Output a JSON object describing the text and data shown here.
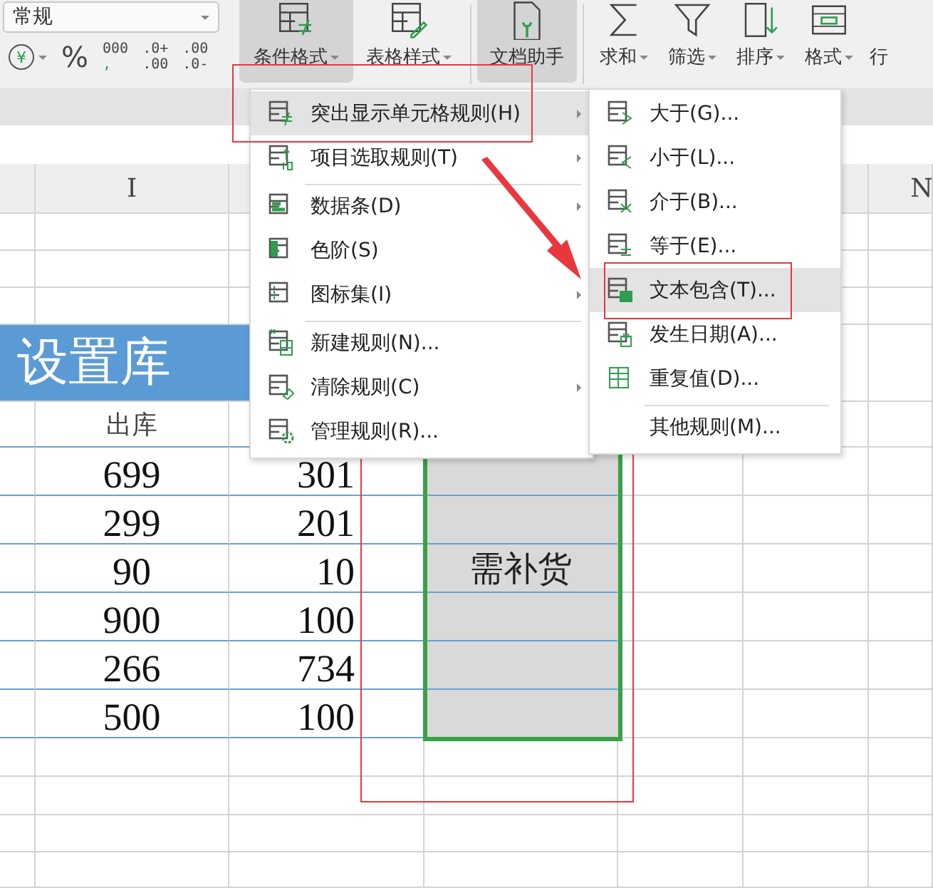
{
  "ribbon": {
    "number_format": "常规",
    "format_buttons": [
      {
        "kind": "currency",
        "label": "¥"
      },
      {
        "kind": "percent",
        "label": "%"
      },
      {
        "kind": "thousands",
        "label": "000",
        "label_2": ","
      },
      {
        "kind": "add_decimal",
        "label": ".0+",
        "label_2": ".00"
      },
      {
        "kind": "remove_decimal",
        "label": ".00",
        "label_2": ".0-"
      }
    ],
    "tools": [
      {
        "kind": "conditional",
        "label": "条件格式",
        "highlighted": true,
        "dropdown": true
      },
      {
        "kind": "table_style",
        "label": "表格样式",
        "highlighted": false,
        "dropdown": true
      },
      {
        "kind": "doc_helper",
        "label": "文档助手",
        "highlighted": true,
        "dropdown": false
      },
      {
        "kind": "sum",
        "label": "求和",
        "highlighted": false,
        "dropdown": true
      },
      {
        "kind": "filter",
        "label": "筛选",
        "highlighted": false,
        "dropdown": true
      },
      {
        "kind": "sort",
        "label": "排序",
        "highlighted": false,
        "dropdown": true
      },
      {
        "kind": "format",
        "label": "格式",
        "highlighted": false,
        "dropdown": true
      },
      {
        "kind": "row",
        "label": "行",
        "highlighted": false,
        "dropdown": false
      }
    ]
  },
  "sheet": {
    "column_headers": [
      "I",
      "N"
    ],
    "title": "设置库",
    "header": "出库",
    "rows": [
      {
        "cells": [
          "699",
          "301"
        ],
        "flagged": true
      },
      {
        "cells": [
          "299",
          "201"
        ],
        "flagged": true
      },
      {
        "cells": [
          "90",
          "10"
        ],
        "flagged": true,
        "note": "需补货"
      },
      {
        "cells": [
          "900",
          "100"
        ],
        "flagged": true
      },
      {
        "cells": [
          "266",
          "734"
        ],
        "flagged": true
      },
      {
        "cells": [
          "500",
          "100"
        ],
        "flagged": true
      }
    ]
  },
  "menu": {
    "items": [
      {
        "kind": "highlight",
        "label": "突出显示单元格规则(H)",
        "selected": true,
        "submenu": true
      },
      {
        "kind": "top",
        "label": "项目选取规则(T)",
        "selected": false,
        "submenu": true
      },
      {
        "kind": "databar",
        "label": "数据条(D)",
        "selected": false,
        "submenu": true,
        "separator_before": true
      },
      {
        "kind": "colorscale",
        "label": "色阶(S)",
        "selected": false,
        "submenu": false
      },
      {
        "kind": "iconset",
        "label": "图标集(I)",
        "selected": false,
        "submenu": true
      },
      {
        "kind": "new",
        "label": "新建规则(N)...",
        "selected": false,
        "submenu": false,
        "separator_before": true
      },
      {
        "kind": "clear",
        "label": "清除规则(C)",
        "selected": false,
        "submenu": true
      },
      {
        "kind": "manage",
        "label": "管理规则(R)...",
        "selected": false,
        "submenu": false
      }
    ]
  },
  "submenu": {
    "items": [
      {
        "kind": "greater",
        "label": "大于(G)...",
        "selected": false
      },
      {
        "kind": "less",
        "label": "小于(L)...",
        "selected": false
      },
      {
        "kind": "between",
        "label": "介于(B)...",
        "selected": false
      },
      {
        "kind": "equal",
        "label": "等于(E)...",
        "selected": false
      },
      {
        "kind": "text",
        "label": "文本包含(T)...",
        "selected": true
      },
      {
        "kind": "date",
        "label": "发生日期(A)...",
        "selected": false
      },
      {
        "kind": "duplicate",
        "label": "重复值(D)...",
        "selected": false
      },
      {
        "kind": "none",
        "label": "其他规则(M)...",
        "selected": false,
        "separator_before": true
      }
    ]
  }
}
